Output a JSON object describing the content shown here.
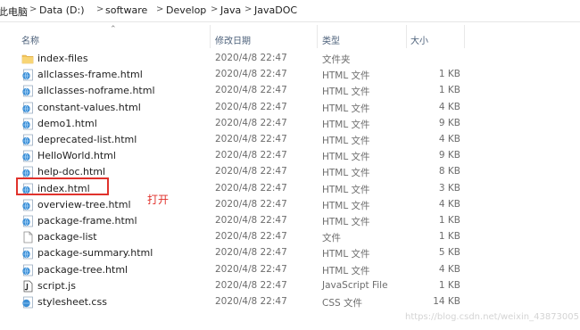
{
  "breadcrumb": [
    "此电脑",
    "Data (D:)",
    "software",
    "Develop",
    "Java",
    "JavaDOC"
  ],
  "columns": {
    "name": "名称",
    "date": "修改日期",
    "type": "类型",
    "size": "大小"
  },
  "files": [
    {
      "name": "index-files",
      "date": "2020/4/8 22:47",
      "type": "文件夹",
      "size": "",
      "icon": "folder-icon"
    },
    {
      "name": "allclasses-frame.html",
      "date": "2020/4/8 22:47",
      "type": "HTML 文件",
      "size": "1 KB",
      "icon": "html-file-icon"
    },
    {
      "name": "allclasses-noframe.html",
      "date": "2020/4/8 22:47",
      "type": "HTML 文件",
      "size": "1 KB",
      "icon": "html-file-icon"
    },
    {
      "name": "constant-values.html",
      "date": "2020/4/8 22:47",
      "type": "HTML 文件",
      "size": "4 KB",
      "icon": "html-file-icon"
    },
    {
      "name": "demo1.html",
      "date": "2020/4/8 22:47",
      "type": "HTML 文件",
      "size": "9 KB",
      "icon": "html-file-icon"
    },
    {
      "name": "deprecated-list.html",
      "date": "2020/4/8 22:47",
      "type": "HTML 文件",
      "size": "4 KB",
      "icon": "html-file-icon"
    },
    {
      "name": "HelloWorld.html",
      "date": "2020/4/8 22:47",
      "type": "HTML 文件",
      "size": "9 KB",
      "icon": "html-file-icon"
    },
    {
      "name": "help-doc.html",
      "date": "2020/4/8 22:47",
      "type": "HTML 文件",
      "size": "8 KB",
      "icon": "html-file-icon"
    },
    {
      "name": "index.html",
      "date": "2020/4/8 22:47",
      "type": "HTML 文件",
      "size": "3 KB",
      "icon": "html-file-icon"
    },
    {
      "name": "overview-tree.html",
      "date": "2020/4/8 22:47",
      "type": "HTML 文件",
      "size": "4 KB",
      "icon": "html-file-icon"
    },
    {
      "name": "package-frame.html",
      "date": "2020/4/8 22:47",
      "type": "HTML 文件",
      "size": "1 KB",
      "icon": "html-file-icon"
    },
    {
      "name": "package-list",
      "date": "2020/4/8 22:47",
      "type": "文件",
      "size": "1 KB",
      "icon": "blank-file-icon"
    },
    {
      "name": "package-summary.html",
      "date": "2020/4/8 22:47",
      "type": "HTML 文件",
      "size": "5 KB",
      "icon": "html-file-icon"
    },
    {
      "name": "package-tree.html",
      "date": "2020/4/8 22:47",
      "type": "HTML 文件",
      "size": "4 KB",
      "icon": "html-file-icon"
    },
    {
      "name": "script.js",
      "date": "2020/4/8 22:47",
      "type": "JavaScript File",
      "size": "1 KB",
      "icon": "js-file-icon"
    },
    {
      "name": "stylesheet.css",
      "date": "2020/4/8 22:47",
      "type": "CSS 文件",
      "size": "14 KB",
      "icon": "css-file-icon"
    }
  ],
  "annotation": "打开",
  "watermark": "https://blog.csdn.net/weixin_43873005",
  "colors": {
    "highlight": "#e0322c",
    "folder": "#f2c55c",
    "header_text": "#4c607a"
  }
}
